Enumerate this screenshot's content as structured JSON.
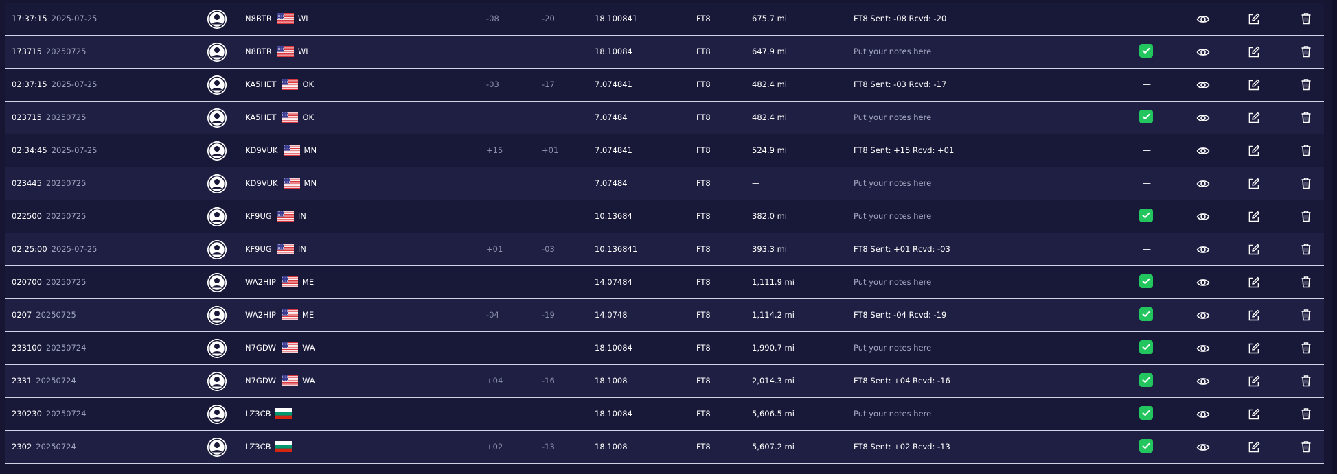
{
  "app": {
    "avatar_icon": "user-avatar-icon",
    "view_icon": "eye-icon",
    "edit_icon": "edit-icon",
    "delete_icon": "trash-icon",
    "confirmed_icon": "check-icon",
    "colors": {
      "row_odd": "#181838",
      "row_even": "#1e1f42",
      "divider": "#cfd3e6",
      "check_green": "#22c55e",
      "muted_text": "#9ea3bf"
    }
  },
  "rows": [
    {
      "time": "17:37:15",
      "date": "2025-07-25",
      "call": "N8BTR",
      "flag": "us",
      "state": "WI",
      "sent": "-08",
      "rcvd": "-20",
      "freq": "18.100841",
      "mode": "FT8",
      "dist": "675.7 mi",
      "notes": "FT8 Sent: -08 Rcvd: -20",
      "notes_placeholder": false,
      "status": "—",
      "confirmed": false
    },
    {
      "time": "173715",
      "date": "20250725",
      "call": "N8BTR",
      "flag": "us",
      "state": "WI",
      "sent": "",
      "rcvd": "",
      "freq": "18.10084",
      "mode": "FT8",
      "dist": "647.9 mi",
      "notes": "Put your notes here",
      "notes_placeholder": true,
      "status": "",
      "confirmed": true
    },
    {
      "time": "02:37:15",
      "date": "2025-07-25",
      "call": "KA5HET",
      "flag": "us",
      "state": "OK",
      "sent": "-03",
      "rcvd": "-17",
      "freq": "7.074841",
      "mode": "FT8",
      "dist": "482.4 mi",
      "notes": "FT8 Sent: -03 Rcvd: -17",
      "notes_placeholder": false,
      "status": "—",
      "confirmed": false
    },
    {
      "time": "023715",
      "date": "20250725",
      "call": "KA5HET",
      "flag": "us",
      "state": "OK",
      "sent": "",
      "rcvd": "",
      "freq": "7.07484",
      "mode": "FT8",
      "dist": "482.4 mi",
      "notes": "Put your notes here",
      "notes_placeholder": true,
      "status": "",
      "confirmed": true
    },
    {
      "time": "02:34:45",
      "date": "2025-07-25",
      "call": "KD9VUK",
      "flag": "us",
      "state": "MN",
      "sent": "+15",
      "rcvd": "+01",
      "freq": "7.074841",
      "mode": "FT8",
      "dist": "524.9 mi",
      "notes": "FT8 Sent: +15 Rcvd: +01",
      "notes_placeholder": false,
      "status": "—",
      "confirmed": false
    },
    {
      "time": "023445",
      "date": "20250725",
      "call": "KD9VUK",
      "flag": "us",
      "state": "MN",
      "sent": "",
      "rcvd": "",
      "freq": "7.07484",
      "mode": "FT8",
      "dist": "—",
      "notes": "Put your notes here",
      "notes_placeholder": true,
      "status": "—",
      "confirmed": false
    },
    {
      "time": "022500",
      "date": "20250725",
      "call": "KF9UG",
      "flag": "us",
      "state": "IN",
      "sent": "",
      "rcvd": "",
      "freq": "10.13684",
      "mode": "FT8",
      "dist": "382.0 mi",
      "notes": "Put your notes here",
      "notes_placeholder": true,
      "status": "",
      "confirmed": true
    },
    {
      "time": "02:25:00",
      "date": "2025-07-25",
      "call": "KF9UG",
      "flag": "us",
      "state": "IN",
      "sent": "+01",
      "rcvd": "-03",
      "freq": "10.136841",
      "mode": "FT8",
      "dist": "393.3 mi",
      "notes": "FT8 Sent: +01 Rcvd: -03",
      "notes_placeholder": false,
      "status": "—",
      "confirmed": false
    },
    {
      "time": "020700",
      "date": "20250725",
      "call": "WA2HIP",
      "flag": "us",
      "state": "ME",
      "sent": "",
      "rcvd": "",
      "freq": "14.07484",
      "mode": "FT8",
      "dist": "1,111.9 mi",
      "notes": "Put your notes here",
      "notes_placeholder": true,
      "status": "",
      "confirmed": true
    },
    {
      "time": "0207",
      "date": "20250725",
      "call": "WA2HIP",
      "flag": "us",
      "state": "ME",
      "sent": "-04",
      "rcvd": "-19",
      "freq": "14.0748",
      "mode": "FT8",
      "dist": "1,114.2 mi",
      "notes": "FT8 Sent: -04 Rcvd: -19",
      "notes_placeholder": false,
      "status": "",
      "confirmed": true
    },
    {
      "time": "233100",
      "date": "20250724",
      "call": "N7GDW",
      "flag": "us",
      "state": "WA",
      "sent": "",
      "rcvd": "",
      "freq": "18.10084",
      "mode": "FT8",
      "dist": "1,990.7 mi",
      "notes": "Put your notes here",
      "notes_placeholder": true,
      "status": "",
      "confirmed": true
    },
    {
      "time": "2331",
      "date": "20250724",
      "call": "N7GDW",
      "flag": "us",
      "state": "WA",
      "sent": "+04",
      "rcvd": "-16",
      "freq": "18.1008",
      "mode": "FT8",
      "dist": "2,014.3 mi",
      "notes": "FT8 Sent: +04 Rcvd: -16",
      "notes_placeholder": false,
      "status": "",
      "confirmed": true
    },
    {
      "time": "230230",
      "date": "20250724",
      "call": "LZ3CB",
      "flag": "bg",
      "state": "",
      "sent": "",
      "rcvd": "",
      "freq": "18.10084",
      "mode": "FT8",
      "dist": "5,606.5 mi",
      "notes": "Put your notes here",
      "notes_placeholder": true,
      "status": "",
      "confirmed": true
    },
    {
      "time": "2302",
      "date": "20250724",
      "call": "LZ3CB",
      "flag": "bg",
      "state": "",
      "sent": "+02",
      "rcvd": "-13",
      "freq": "18.1008",
      "mode": "FT8",
      "dist": "5,607.2 mi",
      "notes": "FT8 Sent: +02 Rcvd: -13",
      "notes_placeholder": false,
      "status": "",
      "confirmed": true
    }
  ]
}
